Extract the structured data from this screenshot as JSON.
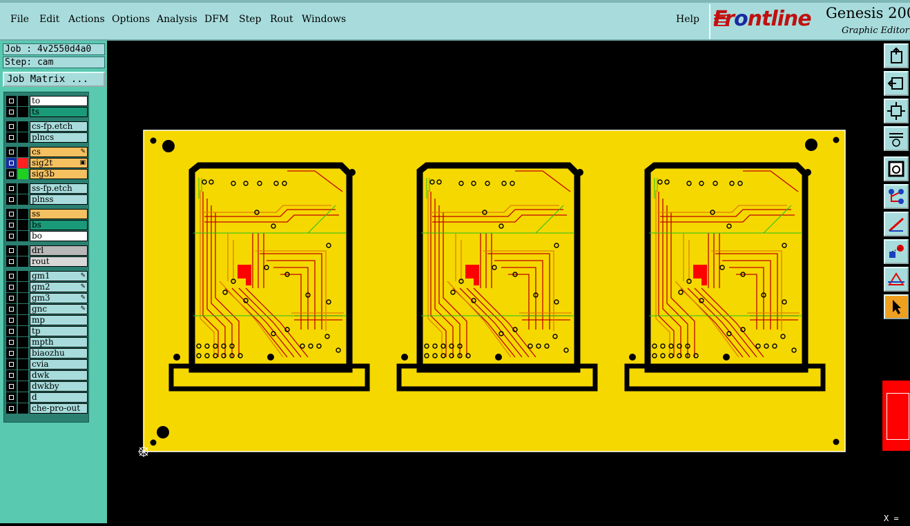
{
  "menubar": {
    "items": [
      {
        "label": "File",
        "underlined": true
      },
      {
        "label": "Edit",
        "underlined": true
      },
      {
        "label": "Actions",
        "underlined": true
      },
      {
        "label": "Options",
        "underlined": false
      },
      {
        "label": "Analysis",
        "underlined": false
      },
      {
        "label": "DFM",
        "underlined": false
      },
      {
        "label": "Step",
        "underlined": true
      },
      {
        "label": "Rout",
        "underlined": true
      },
      {
        "label": "Windows",
        "underlined": true
      }
    ],
    "help_label": "Help"
  },
  "branding": {
    "logo_text_a": "Fr",
    "logo_text_n": "o",
    "logo_text_b": "ntline",
    "product": "Genesis 200",
    "subtitle": "Graphic Editor"
  },
  "info": {
    "job_line": "Job : 4v2550d4a0",
    "step_line": "Step: cam",
    "job_matrix_button": "Job Matrix ..."
  },
  "layers": [
    {
      "name": "to",
      "color": "#ffffff",
      "marker": ""
    },
    {
      "name": "ts",
      "color": "#1a9a78",
      "marker": ""
    },
    {
      "name": "cs-fp.etch",
      "color": "#a8dcdc",
      "marker": ""
    },
    {
      "name": "plncs",
      "color": "#a8dcdc",
      "marker": ""
    },
    {
      "name": "cs",
      "color": "#f5c060",
      "marker": "✎"
    },
    {
      "name": "sig2t",
      "color": "#f5c060",
      "marker": "▣",
      "swatch": "#ff2020",
      "active": true
    },
    {
      "name": "sig3b",
      "color": "#f5c060",
      "marker": "",
      "swatch": "#20d020"
    },
    {
      "name": "ss-fp.etch",
      "color": "#a8dcdc",
      "marker": ""
    },
    {
      "name": "plnss",
      "color": "#a8dcdc",
      "marker": ""
    },
    {
      "name": "ss",
      "color": "#f5c060",
      "marker": ""
    },
    {
      "name": "bs",
      "color": "#1a9a78",
      "marker": ""
    },
    {
      "name": "bo",
      "color": "#ffffff",
      "marker": ""
    },
    {
      "name": "drl",
      "color": "#b8b8b8",
      "marker": ""
    },
    {
      "name": "rout",
      "color": "#d8d8d8",
      "marker": ""
    },
    {
      "name": "gm1",
      "color": "#a8dcdc",
      "marker": "✎"
    },
    {
      "name": "gm2",
      "color": "#a8dcdc",
      "marker": "✎"
    },
    {
      "name": "gm3",
      "color": "#a8dcdc",
      "marker": "✎"
    },
    {
      "name": "gnc",
      "color": "#a8dcdc",
      "marker": "✎"
    },
    {
      "name": "mp",
      "color": "#a8dcdc",
      "marker": ""
    },
    {
      "name": "tp",
      "color": "#a8dcdc",
      "marker": ""
    },
    {
      "name": "mpth",
      "color": "#a8dcdc",
      "marker": ""
    },
    {
      "name": "biaozhu",
      "color": "#a8dcdc",
      "marker": ""
    },
    {
      "name": "cvia",
      "color": "#a8dcdc",
      "marker": ""
    },
    {
      "name": "dwk",
      "color": "#a8dcdc",
      "marker": ""
    },
    {
      "name": "dwkby",
      "color": "#a8dcdc",
      "marker": ""
    },
    {
      "name": "d",
      "color": "#a8dcdc",
      "marker": ""
    },
    {
      "name": "che-pro-out",
      "color": "#a8dcdc",
      "marker": ""
    }
  ],
  "toolbar": [
    "snapshot-icon",
    "zoom-back-icon",
    "zoom-fit-icon",
    "measure-icon",
    "feature-select-icon",
    "net-icon",
    "line-tool-icon",
    "pad-tool-icon",
    "drc-icon",
    "pointer-icon"
  ],
  "status": {
    "coord_label": "X ="
  },
  "colors": {
    "panel_bg": "#yellow-panel",
    "panel": "#f5d800",
    "outline": "#000000",
    "board_fill": "#f5d800"
  }
}
